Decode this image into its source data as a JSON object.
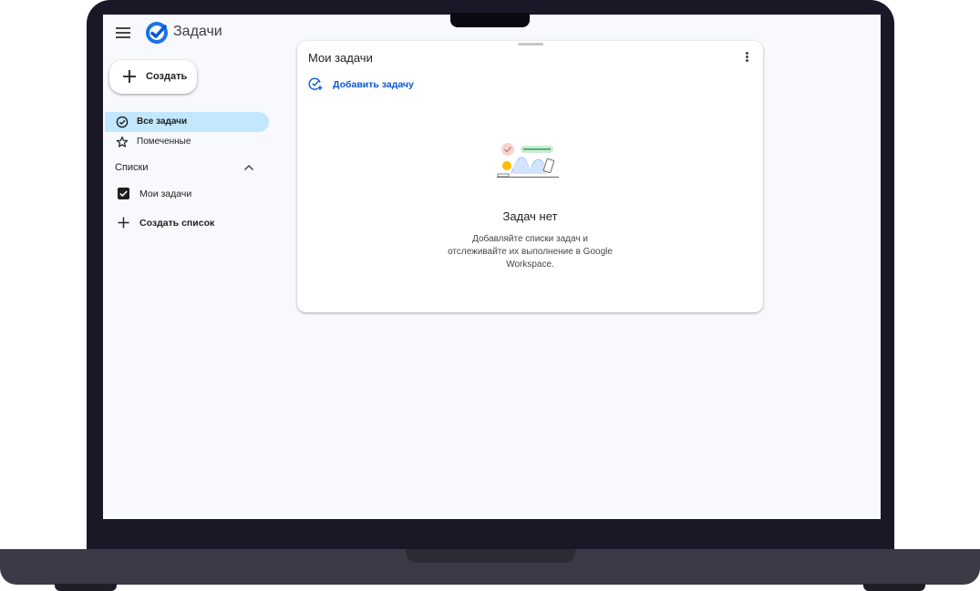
{
  "app": {
    "title": "Задачи",
    "icons": {
      "menu": "hamburger-menu-icon",
      "logo": "tasks-logo-icon"
    }
  },
  "create_button": {
    "label": "Создать",
    "icon": "plus-icon"
  },
  "sidebar": {
    "items": [
      {
        "label": "Все задачи",
        "icon": "check-circle-icon",
        "active": true
      },
      {
        "label": "Помеченные",
        "icon": "star-outline-icon",
        "active": false
      }
    ],
    "lists_header": "Списки",
    "lists": [
      {
        "label": "Мои задачи",
        "checked": true
      }
    ],
    "new_list_label": "Создать список"
  },
  "task_card": {
    "title": "Мои задачи",
    "add_task_label": "Добавить задачу",
    "empty_title": "Задач нет",
    "empty_description": "Добавляйте списки задач и отслеживайте их выполнение в Google Workspace."
  },
  "colors": {
    "accent": "#0b57d0",
    "active_nav_bg": "#c2e7ff",
    "logo_blue": "#1a73e8",
    "screen_bg": "#f8f9fd"
  }
}
